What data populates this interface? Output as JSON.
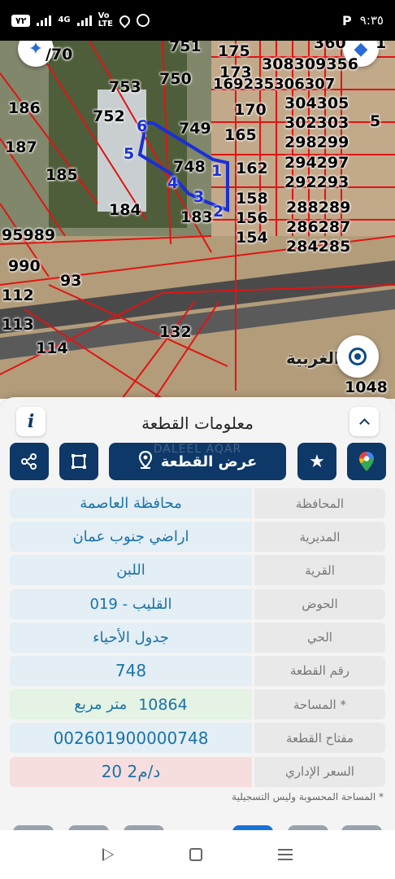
{
  "status_bar": {
    "time": "٩:٣٥",
    "battery": "٧٢",
    "network": "4G",
    "volte_top": "Vo",
    "volte_bottom": "LTE",
    "p_label": "P"
  },
  "map": {
    "plot_numbers": [
      "751",
      "175",
      "360",
      "1",
      "/70",
      "173",
      "308309356",
      "753",
      "750",
      "169235306307",
      "186",
      "752",
      "170",
      "304305",
      "749",
      "5",
      "302303",
      "165",
      "187",
      "298299",
      "185",
      "748",
      "162",
      "294297",
      "292293",
      "184",
      "158",
      "288289",
      "183",
      "156",
      "286287",
      "95989",
      "154",
      "284285",
      "990",
      "93",
      "112",
      "113",
      "132",
      "114",
      "1048"
    ],
    "vertex_labels": [
      "6",
      "5",
      "4",
      "3",
      "2",
      "1"
    ],
    "place_name": "الغربية",
    "colors": {
      "parcel_line": "#e01414",
      "selected_outline": "#1a2fd6"
    },
    "icons": [
      "locate-icon",
      "star-icon"
    ]
  },
  "sheet": {
    "title": "معلومات القطعة",
    "show_plot_label": "عرض القطعة",
    "watermark": "DALEEL AQAR",
    "rows": [
      {
        "label": "المحافظة",
        "value": "محافظة العاصمة"
      },
      {
        "label": "المديرية",
        "value": "اراضي جنوب عمان"
      },
      {
        "label": "القرية",
        "value": "اللبن"
      },
      {
        "label": "الحوض",
        "value": "القليب - 019"
      },
      {
        "label": "الحي",
        "value": "جدول الأحياء"
      },
      {
        "label": "رقم القطعة",
        "value": "748"
      }
    ],
    "area": {
      "label": "المساحة *",
      "number": "10864",
      "unit": "متر مربع"
    },
    "plot_key": {
      "label": "مفتاح القطعة",
      "value": "002601900000748"
    },
    "admin_price": {
      "label": "السعر الإداري",
      "value": "20 د/م2"
    },
    "footnote": "* المساحة المحسوبة وليس التسجيلية",
    "colors": {
      "primary": "#0d3868",
      "value_text": "#1a73a8",
      "green_row": "#e4f3e4",
      "red_row": "#f7dede"
    }
  }
}
